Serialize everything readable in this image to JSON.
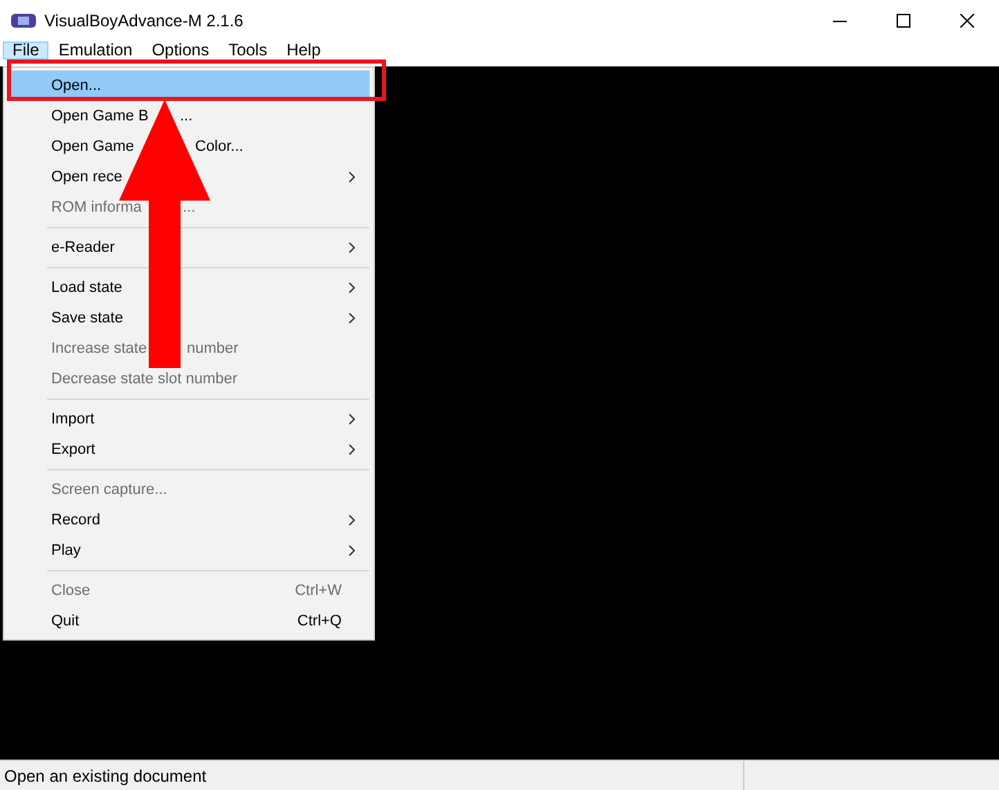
{
  "window": {
    "title": "VisualBoyAdvance-M 2.1.6"
  },
  "menubar": [
    {
      "label": "File",
      "selected": true
    },
    {
      "label": "Emulation",
      "selected": false
    },
    {
      "label": "Options",
      "selected": false
    },
    {
      "label": "Tools",
      "selected": false
    },
    {
      "label": "Help",
      "selected": false
    }
  ],
  "file_menu": [
    {
      "kind": "item",
      "label": [
        "Open..."
      ],
      "selected": true,
      "disabled": false,
      "submenu": false
    },
    {
      "kind": "item",
      "label": [
        "Open Game B",
        "..."
      ],
      "selected": false,
      "disabled": false,
      "submenu": false
    },
    {
      "kind": "item",
      "label": [
        "Open Game",
        "Color..."
      ],
      "selected": false,
      "disabled": false,
      "submenu": false
    },
    {
      "kind": "item",
      "label": [
        "Open rece"
      ],
      "selected": false,
      "disabled": false,
      "submenu": true
    },
    {
      "kind": "item",
      "label": [
        "ROM informa",
        "..."
      ],
      "selected": false,
      "disabled": true,
      "submenu": false
    },
    {
      "kind": "separator"
    },
    {
      "kind": "item",
      "label": [
        "e-Reader"
      ],
      "selected": false,
      "disabled": false,
      "submenu": true
    },
    {
      "kind": "separator"
    },
    {
      "kind": "item",
      "label": [
        "Load state"
      ],
      "selected": false,
      "disabled": false,
      "submenu": true
    },
    {
      "kind": "item",
      "label": [
        "Save state"
      ],
      "selected": false,
      "disabled": false,
      "submenu": true
    },
    {
      "kind": "item",
      "label": [
        "Increase state",
        "number"
      ],
      "selected": false,
      "disabled": true,
      "submenu": false
    },
    {
      "kind": "item",
      "label": [
        "Decrease state slot number"
      ],
      "selected": false,
      "disabled": true,
      "submenu": false
    },
    {
      "kind": "separator"
    },
    {
      "kind": "item",
      "label": [
        "Import"
      ],
      "selected": false,
      "disabled": false,
      "submenu": true
    },
    {
      "kind": "item",
      "label": [
        "Export"
      ],
      "selected": false,
      "disabled": false,
      "submenu": true
    },
    {
      "kind": "separator"
    },
    {
      "kind": "item",
      "label": [
        "Screen capture..."
      ],
      "selected": false,
      "disabled": true,
      "submenu": false
    },
    {
      "kind": "item",
      "label": [
        "Record"
      ],
      "selected": false,
      "disabled": false,
      "submenu": true
    },
    {
      "kind": "item",
      "label": [
        "Play"
      ],
      "selected": false,
      "disabled": false,
      "submenu": true
    },
    {
      "kind": "separator"
    },
    {
      "kind": "item",
      "label": [
        "Close"
      ],
      "selected": false,
      "disabled": true,
      "submenu": false,
      "shortcut": "Ctrl+W"
    },
    {
      "kind": "item",
      "label": [
        "Quit"
      ],
      "selected": false,
      "disabled": false,
      "submenu": false,
      "shortcut": "Ctrl+Q"
    }
  ],
  "status_bar": {
    "text": "Open an existing document"
  }
}
